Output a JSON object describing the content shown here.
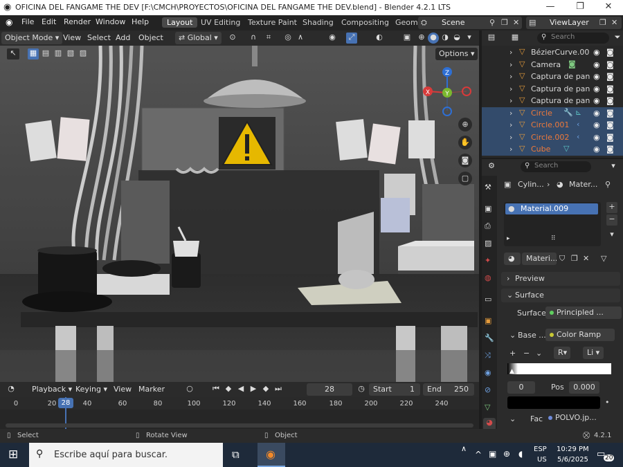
{
  "window": {
    "title": "OFICINA DEL FANGAME  THE DEV [F:\\CMCH\\PROYECTOS\\OFICINA DEL FANGAME  THE DEV.blend] - Blender 4.2.1 LTS"
  },
  "menubar": {
    "items": [
      "File",
      "Edit",
      "Render",
      "Window",
      "Help"
    ]
  },
  "workspaces": [
    "Layout",
    "UV Editing",
    "Texture Paint",
    "Shading",
    "Compositing",
    "Geom"
  ],
  "scene": {
    "scene_name": "Scene",
    "view_layer": "ViewLayer"
  },
  "viewport_header": {
    "mode": "Object Mode",
    "menus": [
      "View",
      "Select",
      "Add",
      "Object"
    ],
    "transform_orientation": "Global",
    "options_label": "Options"
  },
  "navigation_gizmo": {
    "axes": [
      "Z",
      "X",
      "Y"
    ]
  },
  "outliner": {
    "search_placeholder": "Search",
    "rows": [
      {
        "name": "BézierCurve.00",
        "selected": false
      },
      {
        "name": "Camera",
        "selected": false
      },
      {
        "name": "Captura de pan",
        "selected": false
      },
      {
        "name": "Captura de pan",
        "selected": false
      },
      {
        "name": "Captura de pan",
        "selected": false
      },
      {
        "name": "Circle",
        "selected": true
      },
      {
        "name": "Circle.001",
        "selected": true
      },
      {
        "name": "Circle.002",
        "selected": true
      },
      {
        "name": "Cube",
        "selected": true
      }
    ]
  },
  "properties": {
    "search_placeholder": "Search",
    "breadcrumb_object": "Cylin...",
    "breadcrumb_material": "Mater...",
    "material_slot": "Material.009",
    "material_name": "Materi...",
    "preview_label": "Preview",
    "surface_section": "Surface",
    "surface_label": "Surface",
    "surface_value": "Principled ...",
    "base_label": "Base ...",
    "base_value": "Color Ramp",
    "ramp_mode": "R",
    "ramp_interp": "Li",
    "stop_index": "0",
    "pos_label": "Pos",
    "pos_value": "0.000",
    "fac_label": "Fac",
    "fac_value": "POLVO.jp..."
  },
  "timeline": {
    "menus": [
      "Playback",
      "Keying",
      "View",
      "Marker"
    ],
    "current_frame": "28",
    "start_label": "Start",
    "start_value": "1",
    "end_label": "End",
    "end_value": "250",
    "ticks": [
      "0",
      "20",
      "40",
      "60",
      "80",
      "100",
      "120",
      "140",
      "160",
      "180",
      "200",
      "220",
      "240"
    ]
  },
  "statusbar": {
    "select": "Select",
    "rotate": "Rotate View",
    "object": "Object",
    "version": "4.2.1"
  },
  "taskbar": {
    "search_placeholder": "Escribe aquí para buscar.",
    "lang_top": "ESP",
    "lang_bottom": "US",
    "time": "10:29 PM",
    "date": "5/6/2025",
    "notification_count": "20"
  }
}
